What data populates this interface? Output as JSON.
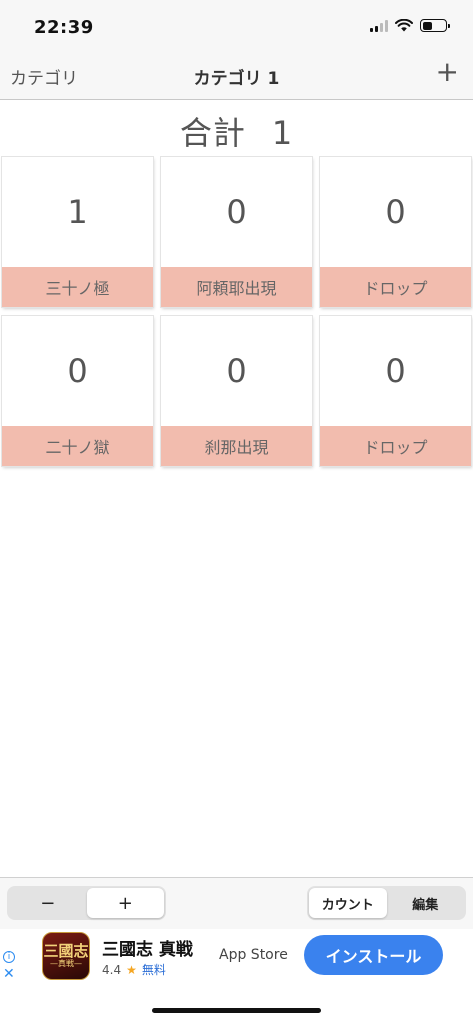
{
  "status": {
    "time": "22:39",
    "battery_level": 0.45
  },
  "nav": {
    "back_label": "カテゴリ",
    "title": "カテゴリ 1",
    "add_icon": "+"
  },
  "total": {
    "label": "合計",
    "value": "1"
  },
  "cards": [
    {
      "count": "1",
      "label": "三十ノ極"
    },
    {
      "count": "0",
      "label": "阿頼耶出現"
    },
    {
      "count": "0",
      "label": "ドロップ"
    },
    {
      "count": "0",
      "label": "二十ノ獄"
    },
    {
      "count": "0",
      "label": "刹那出現"
    },
    {
      "count": "0",
      "label": "ドロップ"
    }
  ],
  "toolbar": {
    "minus_label": "−",
    "plus_label": "+",
    "mode_count_label": "カウント",
    "mode_edit_label": "編集"
  },
  "ad": {
    "app_name": "三國志 真戦",
    "rating": "4.4",
    "price": "無料",
    "store": "App Store",
    "install_label": "インストール",
    "icon_big": "三國志",
    "icon_small": "—真戦—",
    "info_icon": "i",
    "close_icon": "✕",
    "star_icon": "★"
  },
  "colors": {
    "label_bg": "#f2bcae",
    "install_bg": "#3a82ee"
  }
}
